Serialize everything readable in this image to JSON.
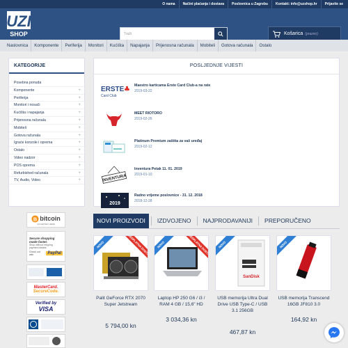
{
  "topbar": {
    "links": [
      "O nama",
      "Načini plaćanja i dostava",
      "Poslovnica u Zagrebu",
      "Kontakt: info@uzshop.hr",
      "Prijavite se"
    ]
  },
  "header": {
    "logo_text_top": "UZI",
    "logo_text_bottom": "SHOP",
    "search_placeholder": "Traži",
    "cart_label": "Košarica",
    "cart_sub": "(prazno)",
    "colors": {
      "header_bg": "#2d5283",
      "topbar_bg": "#1f3b63"
    }
  },
  "nav": {
    "items": [
      "Naslovnica",
      "Komponente",
      "Periferija",
      "Monitori",
      "Kućišta",
      "Napajanja",
      "Prijenosna računala",
      "Mobiteli",
      "Gotova računala",
      "Ostalo"
    ]
  },
  "sidebar": {
    "title": "KATEGORIJE",
    "items": [
      {
        "label": "Posebna ponuda",
        "expandable": false
      },
      {
        "label": "Komponente",
        "expandable": true
      },
      {
        "label": "Periferija",
        "expandable": true
      },
      {
        "label": "Monitori i nosači",
        "expandable": true
      },
      {
        "label": "Kućišta i napajanja",
        "expandable": true
      },
      {
        "label": "Prijenosna računala",
        "expandable": true
      },
      {
        "label": "Mobiteli",
        "expandable": true
      },
      {
        "label": "Gotova računala",
        "expandable": true
      },
      {
        "label": "Igraće konzole i oprema",
        "expandable": true
      },
      {
        "label": "Ostalo",
        "expandable": true
      },
      {
        "label": "Video nadzor",
        "expandable": true
      },
      {
        "label": "POS oprema",
        "expandable": true
      },
      {
        "label": "Refurbished računala",
        "expandable": true
      },
      {
        "label": "TV, Audio, Video",
        "expandable": true
      }
    ]
  },
  "badges": {
    "bitcoin": "bitcoin",
    "bitcoin_sub": "ACCEPTED HERE",
    "paypal_lines": [
      "Secure shopping",
      "made faster.",
      "Shop without retyping",
      "payment details."
    ],
    "paypal_check": "Check out with",
    "paypal": "PayPal",
    "mastercard_1": "MasterCard.",
    "mastercard_2": "SecureCode.",
    "visa_1": "Verified by",
    "visa_2": "VISA"
  },
  "news": {
    "title": "POSLJEDNJE VIJESTI",
    "items": [
      {
        "title": "Maestro karticama Erste Card Club-a na rate",
        "date": "2019-03-22",
        "thumb": "erste"
      },
      {
        "title": "MEET RIOTORO",
        "date": "2019-02-26",
        "thumb": "riotoro"
      },
      {
        "title": "Platinum Premium zaštita za vaš uređaj",
        "date": "2019-02-12",
        "thumb": "fina"
      },
      {
        "title": "Inventura Petak 11. 01. 2019",
        "date": "2019-01-10",
        "thumb": "inventura"
      },
      {
        "title": "Radno vrijeme poslovnice - 31. 12. 2018",
        "date": "2018-12-28",
        "thumb": "2019"
      }
    ],
    "erste_1": "ERSTE",
    "erste_2": "Card Club",
    "inventura": "INVENTURA",
    "year": "2019"
  },
  "tabs": [
    "NOVI PROIZVODI",
    "IZDVOJENO",
    "NAJPRODAVANIJI",
    "PREPORUČENO"
  ],
  "products": [
    {
      "name": "Palit GeForce RTX 2070 Super Jetstream",
      "price": "5 794,00 kn",
      "free_shipping": true,
      "new": true
    },
    {
      "name": "Laptop HP 250 G6 / i3 / RAM 4 GB / 15,6\" HD",
      "price": "3 034,36 kn",
      "free_shipping": true,
      "new": true
    },
    {
      "name": "USB memorija Ultra Dual Drive USB Type-C / USB 3.1 256GB",
      "price": "467,87 kn",
      "free_shipping": false,
      "new": true
    },
    {
      "name": "USB memorija Transcend 16GB JF810 3.0",
      "price": "164,92 kn",
      "free_shipping": false,
      "new": true
    }
  ],
  "ribbons": {
    "new": "NOVO",
    "free": "BESPLATNA DOSTAVA",
    "sandisk": "SanDisk"
  }
}
